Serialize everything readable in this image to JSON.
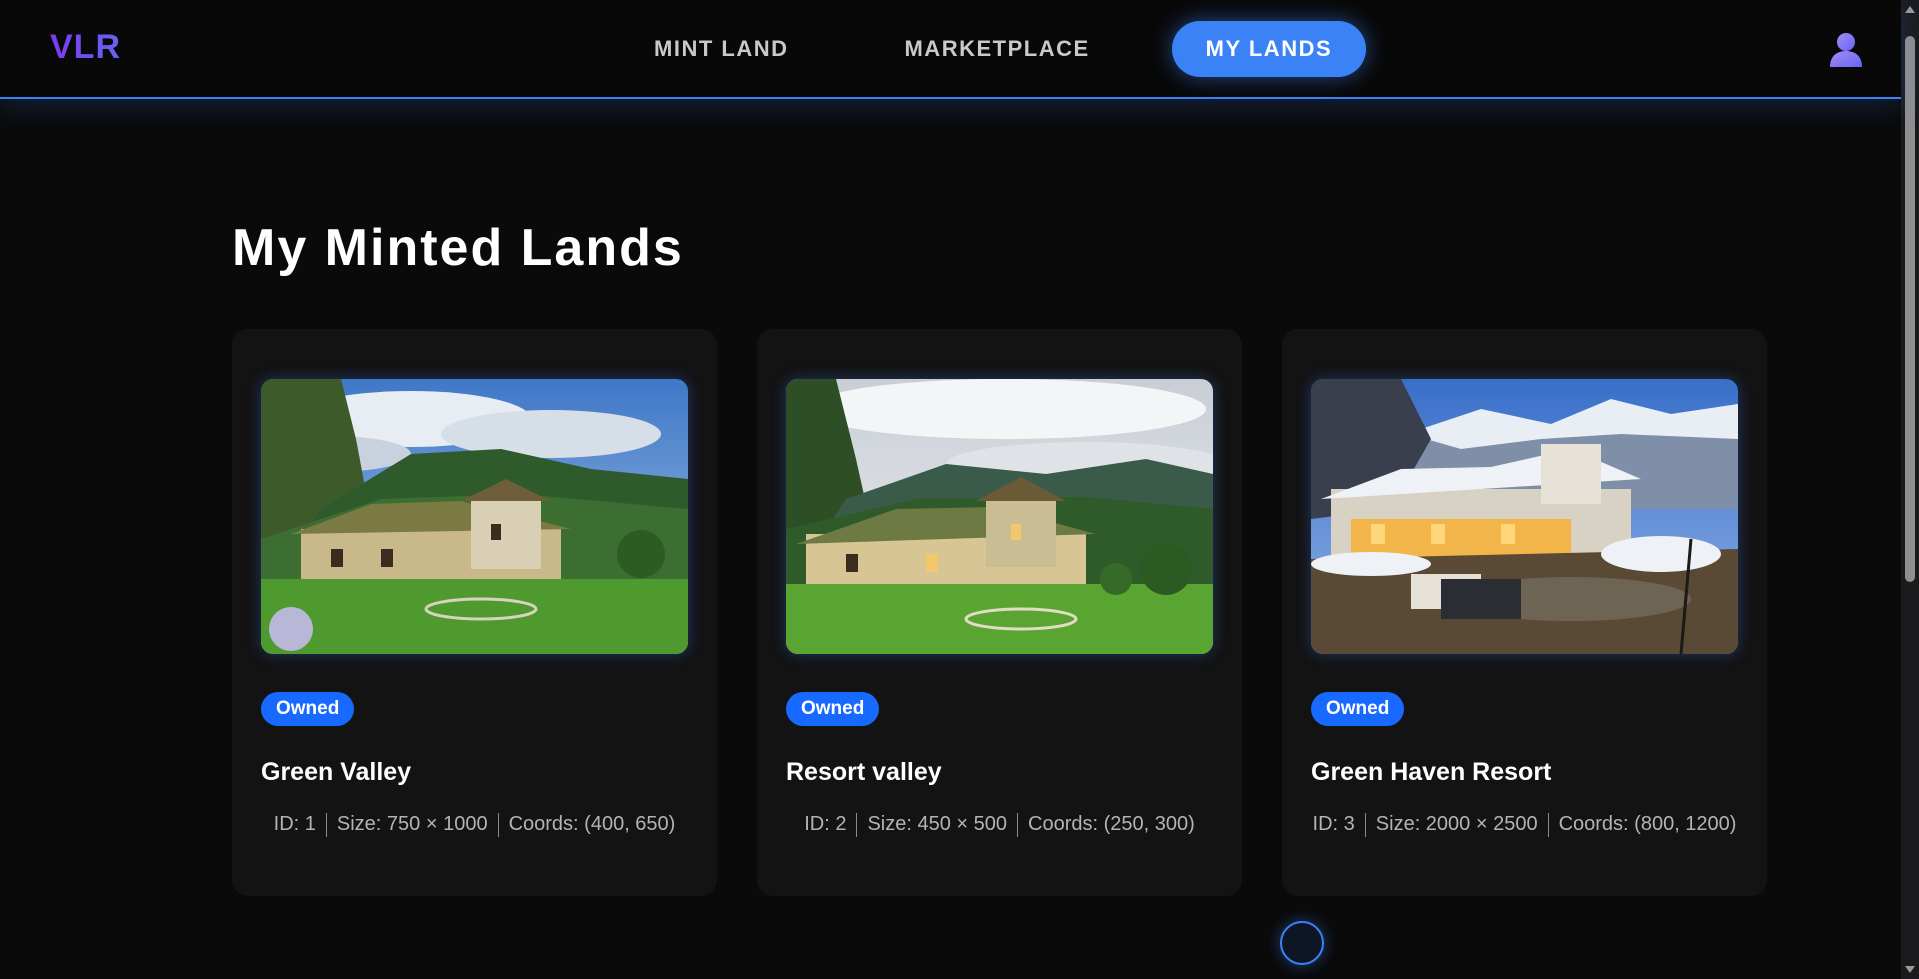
{
  "app": {
    "logo": "VLR"
  },
  "nav": {
    "items": [
      {
        "label": "MINT LAND",
        "active": false
      },
      {
        "label": "MARKETPLACE",
        "active": false
      },
      {
        "label": "MY LANDS",
        "active": true
      }
    ],
    "avatar_icon": "user-avatar-icon"
  },
  "main": {
    "title": "My Minted Lands",
    "cards": [
      {
        "badge": "Owned",
        "name": "Green Valley",
        "id_text": "ID: 1",
        "size_text": "Size: 750 × 1000",
        "coords_text": "Coords: (400, 650)",
        "image": "resort-green-valley-photo"
      },
      {
        "badge": "Owned",
        "name": "Resort valley",
        "id_text": "ID: 2",
        "size_text": "Size: 450 × 500",
        "coords_text": "Coords: (250, 300)",
        "image": "resort-valley-photo"
      },
      {
        "badge": "Owned",
        "name": "Green Haven Resort",
        "id_text": "ID: 3",
        "size_text": "Size: 2000 × 2500",
        "coords_text": "Coords: (800, 1200)",
        "image": "snowy-resort-dusk-photo"
      }
    ]
  },
  "colors": {
    "accent": "#3b82f6",
    "badge": "#1769ff",
    "background": "#0a0a0b",
    "card": "#131314",
    "logo_gradient": [
      "#7c3aed",
      "#6366f1"
    ]
  }
}
